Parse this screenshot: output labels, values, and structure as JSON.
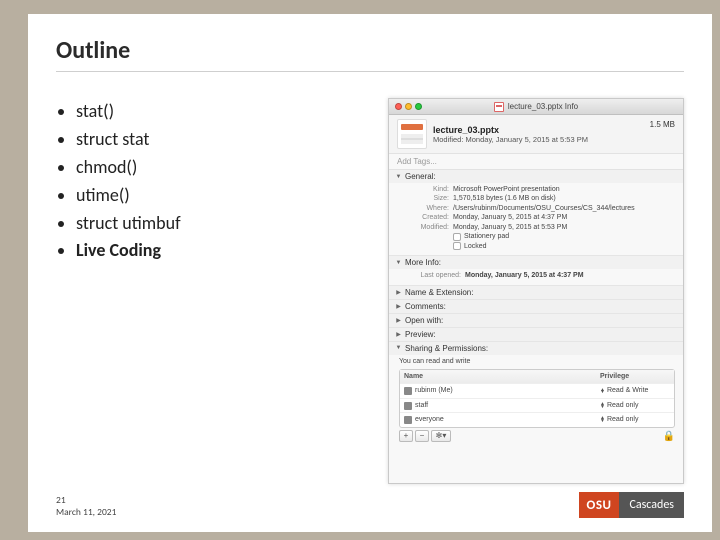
{
  "title": "Outline",
  "bullets": [
    {
      "text": "stat()",
      "bold": false
    },
    {
      "text": "struct stat",
      "bold": false
    },
    {
      "text": "chmod()",
      "bold": false
    },
    {
      "text": "utime()",
      "bold": false
    },
    {
      "text": "struct utimbuf",
      "bold": false
    },
    {
      "text": "Live Coding",
      "bold": true
    }
  ],
  "finder": {
    "window_title": "lecture_03.pptx Info",
    "filename": "lecture_03.pptx",
    "modified_line": "Modified: Monday, January 5, 2015 at 5:53 PM",
    "size_badge": "1.5 MB",
    "add_tags": "Add Tags...",
    "sections": {
      "general": {
        "label": "General:",
        "kind": {
          "k": "Kind:",
          "v": "Microsoft PowerPoint presentation"
        },
        "size": {
          "k": "Size:",
          "v": "1,570,518 bytes (1.6 MB on disk)"
        },
        "where": {
          "k": "Where:",
          "v": "/Users/rubinm/Documents/OSU_Courses/CS_344/lectures"
        },
        "created": {
          "k": "Created:",
          "v": "Monday, January 5, 2015 at 4:37 PM"
        },
        "modified": {
          "k": "Modified:",
          "v": "Monday, January 5, 2015 at 5:53 PM"
        },
        "stationery": "Stationery pad",
        "locked": "Locked"
      },
      "more_info": {
        "label": "More Info:",
        "last_opened": {
          "k": "Last opened:",
          "v": "Monday, January 5, 2015 at 4:37 PM"
        }
      },
      "name_ext": "Name & Extension:",
      "comments": "Comments:",
      "open_with": "Open with:",
      "preview": "Preview:",
      "sharing": {
        "label": "Sharing & Permissions:",
        "you_can": "You can read and write",
        "headers": {
          "name": "Name",
          "priv": "Privilege"
        },
        "rows": [
          {
            "name": "rubinm (Me)",
            "priv": "Read & Write"
          },
          {
            "name": "staff",
            "priv": "Read only"
          },
          {
            "name": "everyone",
            "priv": "Read only"
          }
        ]
      }
    }
  },
  "footer": {
    "page": "21",
    "date": "March 11, 2021",
    "logo_left": "OSU",
    "logo_right": "Cascades"
  }
}
